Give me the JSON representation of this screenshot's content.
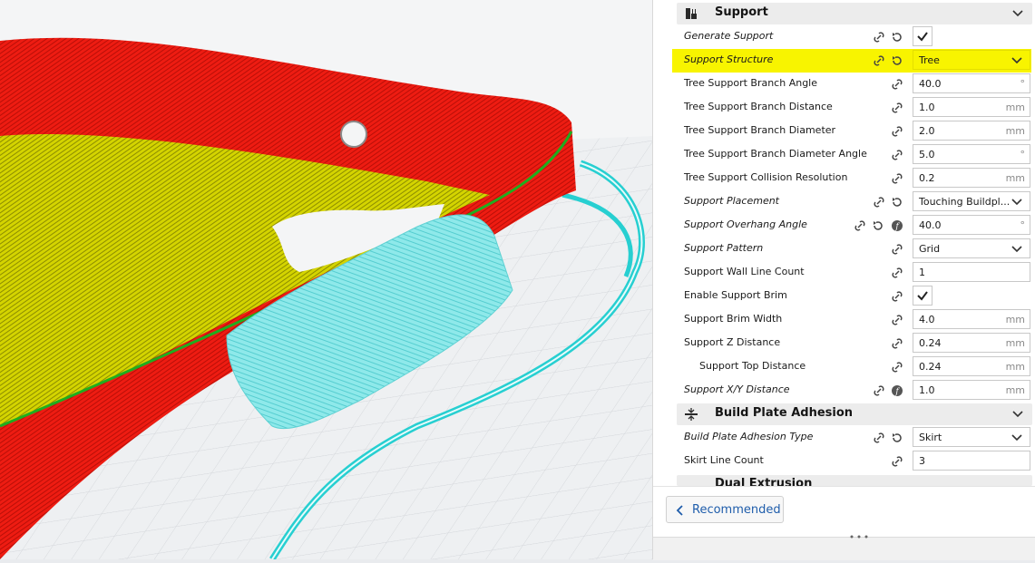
{
  "colors": {
    "model_red": "#ee1c12",
    "infill_yellow": "#d4d400",
    "support_cyan": "#7ee6e6",
    "skirt_cyan": "#27cfd1",
    "highlight_yellow": "#f8f400",
    "accent_blue": "#1f5dab"
  },
  "icons": {
    "support_category": "support-icon",
    "adhesion_category": "build-plate-adhesion-icon",
    "link": "link-icon",
    "reset": "reset-icon",
    "function": "function-icon",
    "check": "check-icon",
    "collapse": "chevron-down-icon"
  },
  "sections": {
    "support": {
      "title": "Support"
    },
    "adhesion": {
      "title": "Build Plate Adhesion"
    },
    "dual": {
      "title": "Dual Extrusion"
    }
  },
  "settings": {
    "generate_support": {
      "label": "Generate Support",
      "checked": true
    },
    "support_structure": {
      "label": "Support Structure",
      "value": "Tree"
    },
    "branch_angle": {
      "label": "Tree Support Branch Angle",
      "value": "40.0",
      "unit": "°"
    },
    "branch_distance": {
      "label": "Tree Support Branch Distance",
      "value": "1.0",
      "unit": "mm"
    },
    "branch_diameter": {
      "label": "Tree Support Branch Diameter",
      "value": "2.0",
      "unit": "mm"
    },
    "branch_diameter_angle": {
      "label": "Tree Support Branch Diameter Angle",
      "value": "5.0",
      "unit": "°"
    },
    "collision_resolution": {
      "label": "Tree Support Collision Resolution",
      "value": "0.2",
      "unit": "mm"
    },
    "support_placement": {
      "label": "Support Placement",
      "value": "Touching Buildpl..."
    },
    "overhang_angle": {
      "label": "Support Overhang Angle",
      "value": "40.0",
      "unit": "°"
    },
    "support_pattern": {
      "label": "Support Pattern",
      "value": "Grid"
    },
    "wall_line_count": {
      "label": "Support Wall Line Count",
      "value": "1"
    },
    "enable_brim": {
      "label": "Enable Support Brim",
      "checked": true
    },
    "brim_width": {
      "label": "Support Brim Width",
      "value": "4.0",
      "unit": "mm"
    },
    "z_distance": {
      "label": "Support Z Distance",
      "value": "0.24",
      "unit": "mm"
    },
    "top_distance": {
      "label": "Support Top Distance",
      "value": "0.24",
      "unit": "mm"
    },
    "xy_distance": {
      "label": "Support X/Y Distance",
      "value": "1.0",
      "unit": "mm"
    },
    "adhesion_type": {
      "label": "Build Plate Adhesion Type",
      "value": "Skirt"
    },
    "skirt_line_count": {
      "label": "Skirt Line Count",
      "value": "3"
    }
  },
  "footer": {
    "recommended_label": "Recommended"
  }
}
